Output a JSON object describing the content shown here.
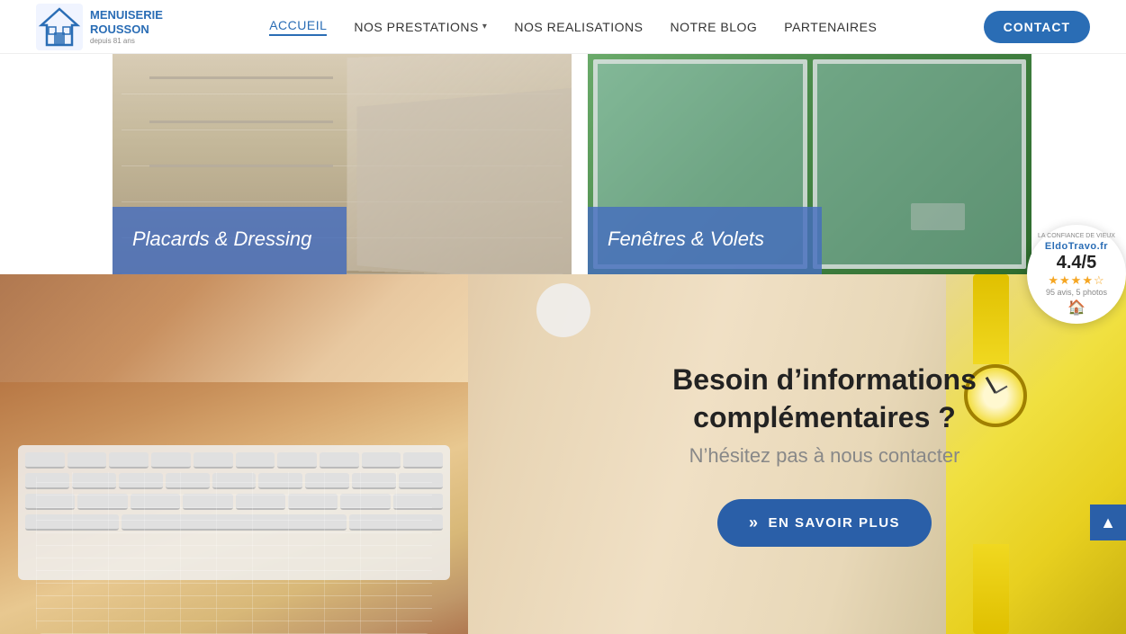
{
  "header": {
    "logo_alt": "Menuiserie Rousson",
    "nav_items": [
      {
        "label": "ACCUEIL",
        "active": true,
        "has_dropdown": false
      },
      {
        "label": "NOS PRESTATIONS",
        "active": false,
        "has_dropdown": true
      },
      {
        "label": "NOS REALISATIONS",
        "active": false,
        "has_dropdown": false
      },
      {
        "label": "NOTRE BLOG",
        "active": false,
        "has_dropdown": false
      },
      {
        "label": "PARTENAIRES",
        "active": false,
        "has_dropdown": false
      }
    ],
    "contact_btn_label": "CONTACT"
  },
  "gallery": {
    "items": [
      {
        "label": "Placards & Dressing"
      },
      {
        "label": "Fenêtres & Volets"
      }
    ]
  },
  "cta": {
    "title": "Besoin d’informations complémentaires ?",
    "subtitle": "N’hésitez pas à nous contacter",
    "btn_label": "EN SAVOIR PLUS",
    "btn_arrows": "»"
  },
  "eldo": {
    "site": "EldoTravo.fr",
    "trust_text": "LA CONFIANCE DE VIEUX",
    "rating": "4.4/5",
    "stars": "★★★★☆",
    "reviews": "95 avis, 5 photos"
  },
  "scroll_top": {
    "icon": "▲"
  }
}
